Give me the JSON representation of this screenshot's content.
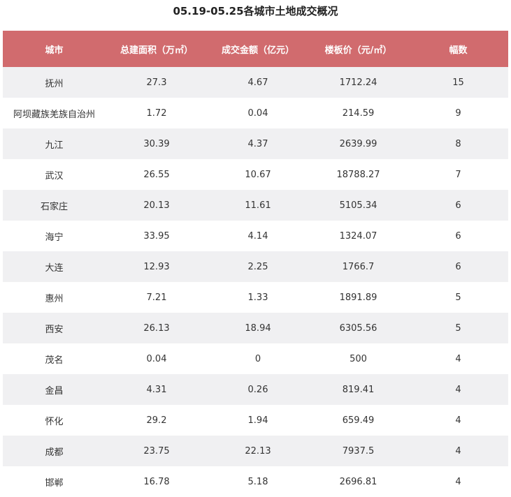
{
  "title": "05.19-05.25各城市土地成交概况",
  "colors": {
    "header_bg": "#d16b6e",
    "header_text": "#ffffff",
    "row_alt_bg": "#f0f0f2"
  },
  "table": {
    "headers": [
      "城市",
      "总建面积（万㎡）",
      "成交金额（亿元）",
      "楼板价（元/㎡）",
      "幅数"
    ],
    "rows": [
      [
        "抚州",
        "27.3",
        "4.67",
        "1712.24",
        "15"
      ],
      [
        "阿坝藏族羌族自治州",
        "1.72",
        "0.04",
        "214.59",
        "9"
      ],
      [
        "九江",
        "30.39",
        "4.37",
        "2639.99",
        "8"
      ],
      [
        "武汉",
        "26.55",
        "10.67",
        "18788.27",
        "7"
      ],
      [
        "石家庄",
        "20.13",
        "11.61",
        "5105.34",
        "6"
      ],
      [
        "海宁",
        "33.95",
        "4.14",
        "1324.07",
        "6"
      ],
      [
        "大连",
        "12.93",
        "2.25",
        "1766.7",
        "6"
      ],
      [
        "惠州",
        "7.21",
        "1.33",
        "1891.89",
        "5"
      ],
      [
        "西安",
        "26.13",
        "18.94",
        "6305.56",
        "5"
      ],
      [
        "茂名",
        "0.04",
        "0",
        "500",
        "4"
      ],
      [
        "金昌",
        "4.31",
        "0.26",
        "819.41",
        "4"
      ],
      [
        "怀化",
        "29.2",
        "1.94",
        "659.49",
        "4"
      ],
      [
        "成都",
        "23.75",
        "22.13",
        "7937.5",
        "4"
      ],
      [
        "邯郸",
        "16.78",
        "5.18",
        "2696.81",
        "4"
      ]
    ]
  }
}
